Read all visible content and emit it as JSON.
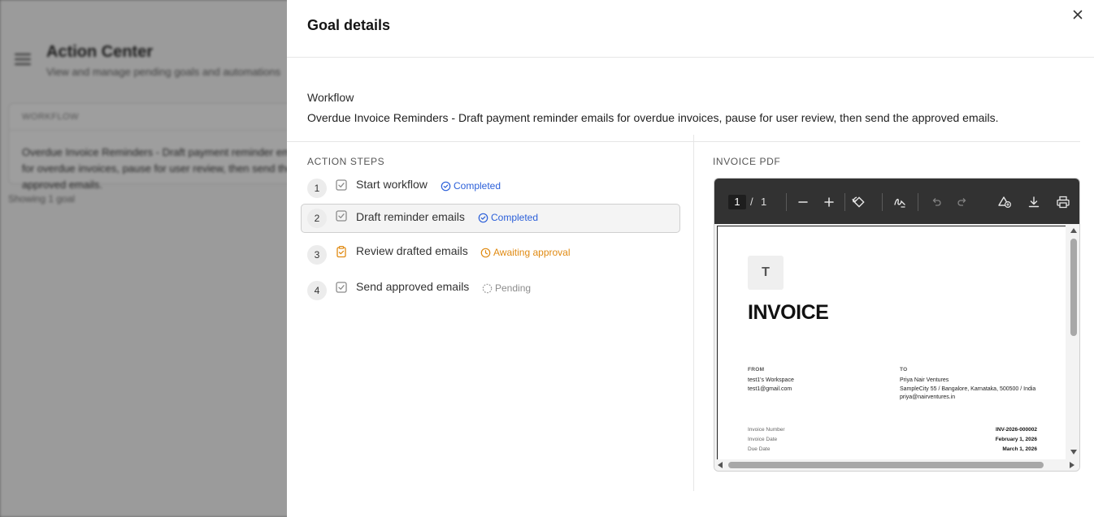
{
  "background": {
    "title": "Action Center",
    "subtitle": "View and manage pending goals and automations",
    "card_label": "WORKFLOW",
    "card_text": "Overdue Invoice Reminders - Draft payment reminder emails for overdue invoices, pause for user review, then send the approved emails.",
    "showing": "Showing 1 goal"
  },
  "drawer": {
    "title": "Goal details",
    "workflow_label": "Workflow",
    "workflow_desc": "Overdue Invoice Reminders - Draft payment reminder emails for overdue invoices, pause for user review, then send the approved emails.",
    "steps_label": "ACTION STEPS",
    "pdf_label": "INVOICE PDF"
  },
  "steps": [
    {
      "num": "1",
      "name": "Start workflow",
      "status": "Completed",
      "status_type": "completed",
      "icon": "checkbox-icon"
    },
    {
      "num": "2",
      "name": "Draft reminder emails",
      "status": "Completed",
      "status_type": "completed",
      "icon": "checkbox-icon"
    },
    {
      "num": "3",
      "name": "Review drafted emails",
      "status": "Awaiting approval",
      "status_type": "awaiting",
      "icon": "clipboard-check-icon"
    },
    {
      "num": "4",
      "name": "Send approved emails",
      "status": "Pending",
      "status_type": "pending",
      "icon": "checkbox-icon"
    }
  ],
  "pdf_viewer": {
    "current_page": "1",
    "separator": "/",
    "total_pages": "1"
  },
  "invoice": {
    "logo_letter": "T",
    "title": "INVOICE",
    "from_label": "FROM",
    "from_name": "test1's Workspace",
    "from_email": "test1@gmail.com",
    "to_label": "TO",
    "to_name": "Priya Nair Ventures",
    "to_address": "SampleCity 55 / Bangalore, Karnataka, 500500 / India",
    "to_email": "priya@nairventures.in",
    "invoice_number_label": "Invoice Number",
    "invoice_number": "INV-2026-000002",
    "invoice_date_label": "Invoice Date",
    "invoice_date": "February 1, 2026",
    "due_date_label": "Due Date",
    "due_date": "March 1, 2026"
  },
  "colors": {
    "completed": "#2b5fd9",
    "awaiting": "#e08a12",
    "pending": "#8c8c8c"
  }
}
